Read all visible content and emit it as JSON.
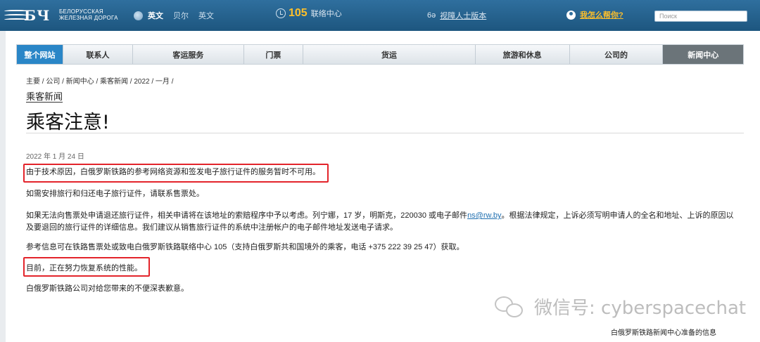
{
  "header": {
    "logo_text_line1": "БЕЛОРУССКАЯ",
    "logo_text_line2": "ЖЕЛЕЗНАЯ ДОРОГА",
    "logo_mark": "БЧ",
    "languages": [
      "英文",
      "贝尔",
      "英文"
    ],
    "contact_number": "105",
    "contact_label": "联络中心",
    "vision_icon_text": "6ə",
    "vision_label": "视障人士版本",
    "help_label": "我怎么帮你?",
    "search_placeholder": "Поиск"
  },
  "nav": {
    "items": [
      "整个网站",
      "联系人",
      "客运服务",
      "门票",
      "货运",
      "旅游和休息",
      "公司的",
      "新闻中心"
    ]
  },
  "breadcrumb": {
    "text": "主要 / 公司 / 新闻中心 / 乘客新闻 / 2022 / 一月 /"
  },
  "section_title": "乘客新闻",
  "page_title": "乘客注意!",
  "article": {
    "date": "2022 年 1 月 24 日",
    "p1": "由于技术原因，白俄罗斯铁路的参考网络资源和签发电子旅行证件的服务暂时不可用。",
    "p2": "如需安排旅行和归还电子旅行证件，请联系售票处。",
    "p3a": "如果无法向售票处申请退还旅行证件，相关申请将在该地址的索赔程序中予以考虑。列宁娜，17 岁，明斯克，220030 或电子邮件",
    "p3_email": "ns@rw.by",
    "p3b": "。根据法律规定，上诉必须写明申请人的全名和地址、上诉的原因以及要退回的旅行证件的详细信息。我们建议从销售旅行证件的系统中注册帐户的电子邮件地址发送电子请求。",
    "p4": "参考信息可在铁路售票处或致电白俄罗斯铁路联络中心 105（支持白俄罗斯共和国境外的乘客，电话 +375 222 39 25 47）获取。",
    "p5": "目前，正在努力恢复系统的性能。",
    "p6": "白俄罗斯铁路公司对给您带来的不便深表歉意。",
    "signature": "白俄罗斯铁路新闻中心准备的信息"
  },
  "watermark": {
    "text": "微信号: cyberspacechat"
  },
  "colors": {
    "header_blue": "#1d567f",
    "accent_yellow": "#ffc02a",
    "nav_active": "#2a86c7",
    "nav_last": "#6b7479",
    "highlight_red": "#e3242b"
  }
}
